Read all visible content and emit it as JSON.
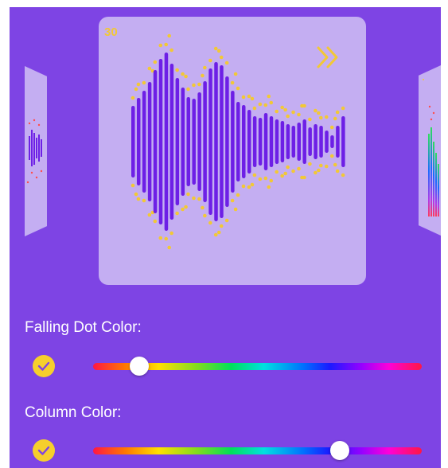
{
  "visualizer": {
    "counter": "30",
    "dot_color": "#f2c836",
    "column_color": "#6d1fe6",
    "card_color": "#c4aef2"
  },
  "settings": {
    "falling_dot_color": {
      "label": "Falling Dot Color:",
      "checked": true,
      "hue_position": 0.14
    },
    "column_color": {
      "label": "Column Color:",
      "checked": true,
      "hue_position": 0.75
    }
  },
  "icons": {
    "fast_forward": "fast-forward-icon",
    "check": "check-icon"
  }
}
